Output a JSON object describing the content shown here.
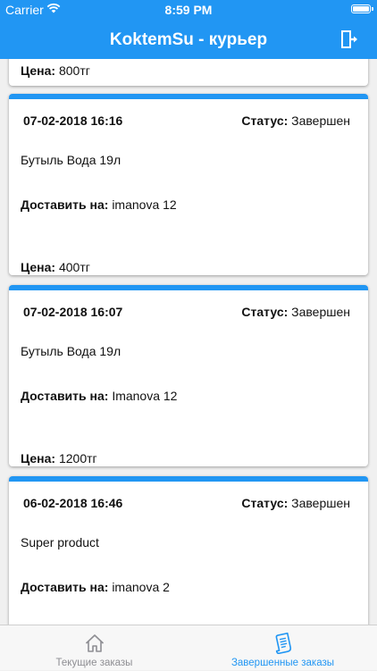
{
  "status_bar": {
    "carrier": "Carrier",
    "time": "8:59 PM"
  },
  "header": {
    "title": "KoktemSu - курьер"
  },
  "colors": {
    "accent": "#2196f3",
    "tab_inactive": "#8e8e93"
  },
  "icons": {
    "logout": "logout-icon",
    "tab_current": "home-icon",
    "tab_completed": "receipt-icon"
  },
  "partial_card": {
    "price_label": "Цена:",
    "price_value": "800тг"
  },
  "orders": [
    {
      "date": "07-02-2018 16:16",
      "status_label": "Статус:",
      "status_value": "Завершен",
      "product": "Бутыль Вода 19л",
      "deliver_label": "Доставить на:",
      "deliver_value": "imanova 12",
      "price_label": "Цена:",
      "price_value": "400тг"
    },
    {
      "date": "07-02-2018 16:07",
      "status_label": "Статус:",
      "status_value": "Завершен",
      "product": "Бутыль Вода 19л",
      "deliver_label": "Доставить на:",
      "deliver_value": "Imanova 12",
      "price_label": "Цена:",
      "price_value": "1200тг"
    },
    {
      "date": "06-02-2018 16:46",
      "status_label": "Статус:",
      "status_value": "Завершен",
      "product": "Super product",
      "deliver_label": "Доставить на:",
      "deliver_value": "imanova 2"
    }
  ],
  "tabs": [
    {
      "label": "Текущие заказы",
      "active": false
    },
    {
      "label": "Завершенные заказы",
      "active": true
    }
  ]
}
